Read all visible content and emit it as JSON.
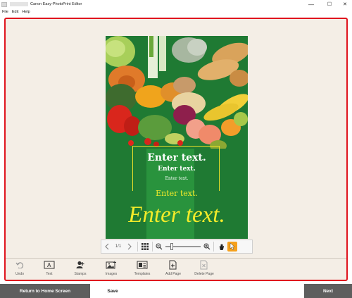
{
  "window": {
    "title": "Canon Easy-PhotoPrint Editor",
    "minimize_glyph": "—",
    "maximize_glyph": "☐",
    "close_glyph": "✕"
  },
  "menu": {
    "items": [
      "File",
      "Edit",
      "Help"
    ]
  },
  "poster": {
    "texts": [
      "Enter text.",
      "Enter text.",
      "Enter text.",
      "Enter text.",
      "Enter text."
    ],
    "colors": {
      "background": "#1f7a33",
      "band": "#29933d",
      "frame": "#e8de2a",
      "yellow_text": "#f3eb2a"
    }
  },
  "zoombar": {
    "page_indicator": "1/1",
    "prev_icon": "chevron-left-icon",
    "next_icon": "chevron-right-icon",
    "zoom_out_icon": "zoom-out-icon",
    "zoom_in_icon": "zoom-in-icon",
    "zoom_level": 0.15
  },
  "tools": {
    "undo": "Undo",
    "text": "Text",
    "stamps": "Stamps",
    "images": "Images",
    "templates": "Templates",
    "add_page": "Add Page",
    "delete_page": "Delete Page"
  },
  "footer": {
    "home": "Return to Home Screen",
    "save": "Save",
    "next": "Next"
  },
  "colors": {
    "accent": "#e0141e",
    "pointer_active": "#f5a01c",
    "footer_dark": "#5e5e5e"
  }
}
